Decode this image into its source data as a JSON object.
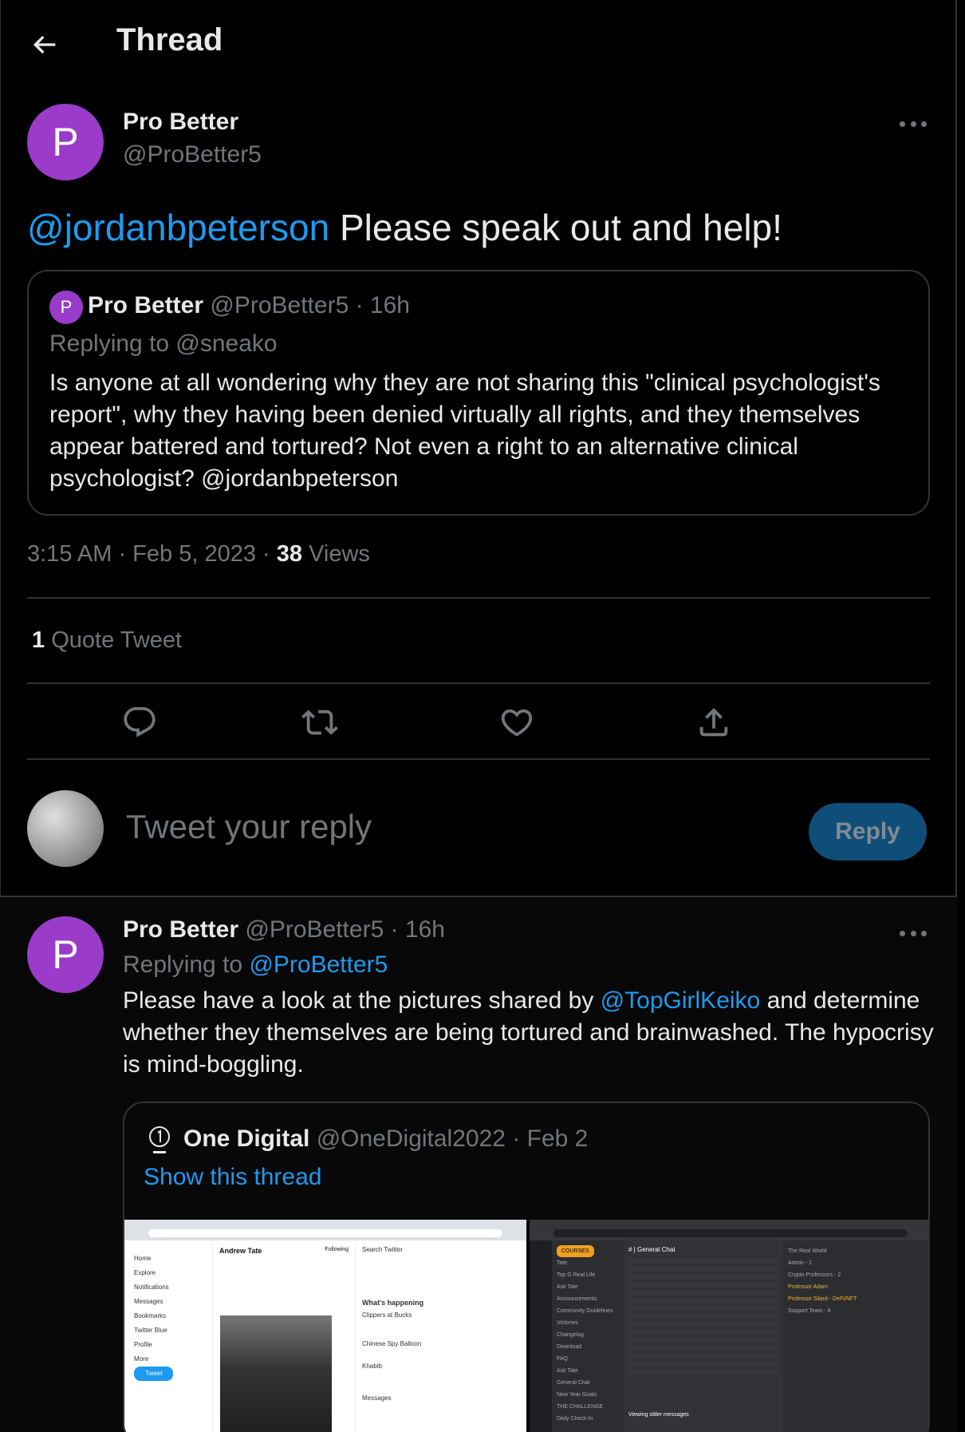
{
  "header": {
    "title": "Thread"
  },
  "main_tweet": {
    "avatar_letter": "P",
    "name": "Pro Better",
    "handle": "@ProBetter5",
    "mention": "@jordanbpeterson",
    "text": " Please speak out and help!",
    "timestamp": "3:15 AM · Feb 5, 2023 · ",
    "views_count": "38",
    "views_label": " Views",
    "quote_count": "1",
    "quote_label": " Quote Tweet"
  },
  "quoted_tweet": {
    "avatar_letter": "P",
    "name": "Pro Better",
    "handle": "@ProBetter5 · 16h",
    "replying_to": "Replying to @sneako",
    "text": "Is anyone at all wondering why they are not sharing this \"clinical psychologist's report\", why they having been denied virtually all rights, and they themselves appear battered and tortured?  Not even a right to an alternative clinical psychologist? @jordanbpeterson"
  },
  "reply_box": {
    "placeholder": "Tweet your reply",
    "button": "Reply"
  },
  "reply_tweet": {
    "avatar_letter": "P",
    "name": "Pro Better",
    "handle": "@ProBetter5 · 16h",
    "replying_prefix": "Replying to ",
    "replying_handle": "@ProBetter5",
    "text_a": "Please have a look at the pictures shared by ",
    "mention": "@TopGirlKeiko",
    "text_b": " and determine whether they themselves are being tortured and brainwashed. The hypocrisy is mind-boggling.",
    "quote": {
      "name": "One Digital",
      "handle": "@OneDigital2022 · Feb 2",
      "show_thread": "Show this thread",
      "shot1": {
        "profile_name": "Andrew Tate",
        "nav": [
          "Home",
          "Explore",
          "Notifications",
          "Messages",
          "Bookmarks",
          "Twitter Blue",
          "Profile",
          "More"
        ],
        "tweet_button": "Tweet",
        "follow": "Following",
        "right": [
          "Search Twitter",
          "What's happening",
          "Clippers at Bucks",
          "Chinese Spy Balloon",
          "Khabib",
          "Messages"
        ]
      },
      "shot2": {
        "channel_title": "# | General Chat",
        "courses": "COURSES",
        "channels": [
          "Tate",
          "Top G Real Life",
          "Ask Tate",
          "Announcements",
          "Community Guidelines",
          "Victories",
          "Changelog",
          "Download",
          "FAQ",
          "Ask Tate",
          "General Chat",
          "New Year Goals",
          "THE CHALLENGE",
          "Daily Check-In"
        ],
        "members": [
          "The Real World",
          "Admin - 1",
          "Crypto Professors - 2",
          "Professor Adam",
          "Professor Silard - DeFi/NFT",
          "Support Team - 8"
        ],
        "status": "Viewing older messages"
      }
    }
  },
  "colors": {
    "accent": "#1d9bf0",
    "avatar": "#9a3bc9",
    "muted": "#71767b",
    "border": "#2f3336"
  }
}
